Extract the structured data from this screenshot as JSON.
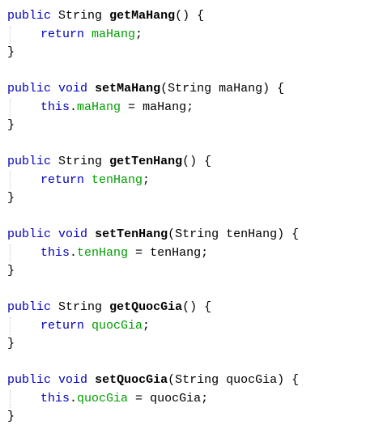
{
  "methods": [
    {
      "signature": {
        "modifier": "public",
        "return_type": "String",
        "name": "getMaHang",
        "params": "()",
        "open": "{"
      },
      "body": {
        "kind": "return",
        "keyword": "return",
        "field": "maHang",
        "end": ";"
      },
      "close": "}"
    },
    {
      "signature": {
        "modifier": "public",
        "return_type": "void",
        "name": "setMaHang",
        "params": "(String maHang)",
        "open": "{"
      },
      "body": {
        "kind": "assign",
        "keyword": "this",
        "dot": ".",
        "field": "maHang",
        "op": " = ",
        "value": "maHang",
        "end": ";"
      },
      "close": "}"
    },
    {
      "signature": {
        "modifier": "public",
        "return_type": "String",
        "name": "getTenHang",
        "params": "()",
        "open": "{"
      },
      "body": {
        "kind": "return",
        "keyword": "return",
        "field": "tenHang",
        "end": ";"
      },
      "close": "}"
    },
    {
      "signature": {
        "modifier": "public",
        "return_type": "void",
        "name": "setTenHang",
        "params": "(String tenHang)",
        "open": "{"
      },
      "body": {
        "kind": "assign",
        "keyword": "this",
        "dot": ".",
        "field": "tenHang",
        "op": " = ",
        "value": "tenHang",
        "end": ";"
      },
      "close": "}"
    },
    {
      "signature": {
        "modifier": "public",
        "return_type": "String",
        "name": "getQuocGia",
        "params": "()",
        "open": "{"
      },
      "body": {
        "kind": "return",
        "keyword": "return",
        "field": "quocGia",
        "end": ";"
      },
      "close": "}"
    },
    {
      "signature": {
        "modifier": "public",
        "return_type": "void",
        "name": "setQuocGia",
        "params": "(String quocGia)",
        "open": "{"
      },
      "body": {
        "kind": "assign",
        "keyword": "this",
        "dot": ".",
        "field": "quocGia",
        "op": " = ",
        "value": "quocGia",
        "end": ";"
      },
      "close": "}"
    }
  ],
  "colors": {
    "keyword": "#0000c0",
    "field": "#00a000",
    "text": "#000000",
    "background": "#ffffff"
  }
}
